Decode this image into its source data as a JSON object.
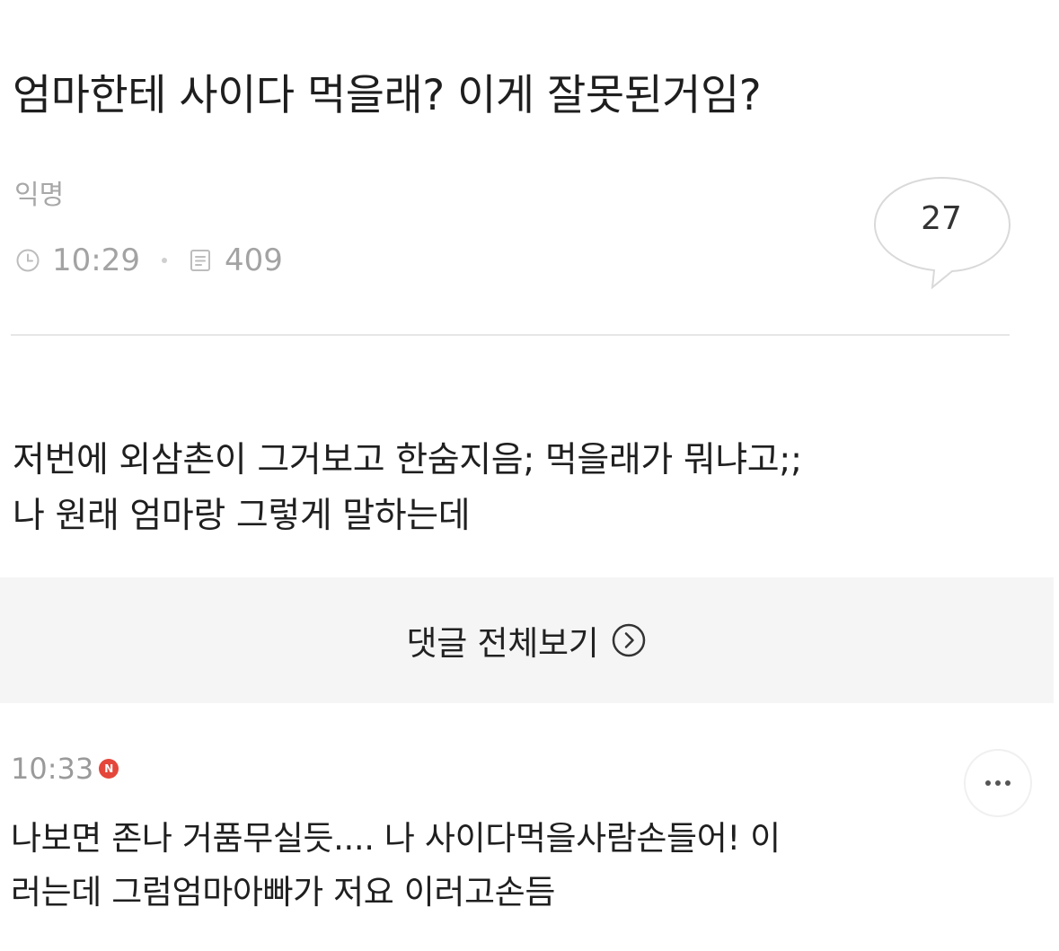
{
  "post": {
    "title": "엄마한테 사이다 먹을래? 이게 잘못된거임?",
    "author": "익명",
    "time": "10:29",
    "views": "409",
    "comment_count": "27",
    "body_lines": [
      "저번에 외삼촌이 그거보고 한숨지음; 먹을래가 뭐냐고;;",
      "나 원래 엄마랑 그렇게 말하는데"
    ]
  },
  "actions": {
    "view_all_comments": "댓글 전체보기"
  },
  "comment": {
    "time": "10:33",
    "badge": "N",
    "lines": [
      "나보면 존나 거품무실듯.... 나 사이다먹을사람손들어! 이",
      "러는데 그럼엄마아빠가 저요 이러고손듬"
    ]
  },
  "icons": {
    "time": "clock-icon",
    "views": "document-icon",
    "comments": "speech-bubble-icon",
    "view_all": "chevron-right-circle-icon",
    "more": "more-dots-icon"
  },
  "colors": {
    "badge": "#e4463b",
    "meta_text": "#a3a3a3",
    "panel_bg": "#f5f5f5"
  }
}
